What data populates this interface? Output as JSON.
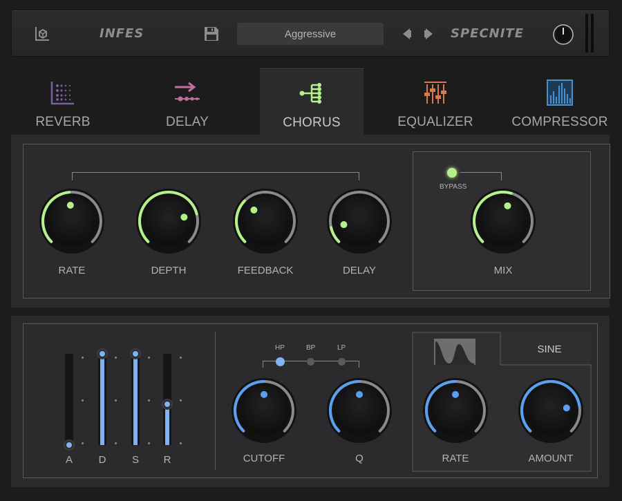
{
  "header": {
    "brand_left": "INFES",
    "preset_name": "Aggressive",
    "brand_right": "SPECNITE"
  },
  "tabs": [
    {
      "label": "REVERB",
      "icon": "reverb-dots-icon",
      "color": "#7a5fa0"
    },
    {
      "label": "DELAY",
      "icon": "delay-arrow-icon",
      "color": "#c06e9a"
    },
    {
      "label": "CHORUS",
      "icon": "chorus-tree-icon",
      "color": "#b6f08a",
      "active": true
    },
    {
      "label": "EQUALIZER",
      "icon": "equalizer-sliders-icon",
      "color": "#d87a4e"
    },
    {
      "label": "COMPRESSOR",
      "icon": "compressor-meter-icon",
      "color": "#4a8fcf"
    }
  ],
  "chorus": {
    "knobs": [
      {
        "label": "RATE",
        "value": 0.48
      },
      {
        "label": "DEPTH",
        "value": 0.78
      },
      {
        "label": "FEEDBACK",
        "value": 0.33
      },
      {
        "label": "DELAY",
        "value": 0.12
      }
    ],
    "bypass_label": "BYPASS",
    "mix": {
      "label": "MIX",
      "value": 0.56
    },
    "accent": "#b6f08a"
  },
  "envelope": {
    "sliders": [
      {
        "label": "A",
        "value": 0.0
      },
      {
        "label": "D",
        "value": 1.0
      },
      {
        "label": "S",
        "value": 1.0
      },
      {
        "label": "R",
        "value": 0.45
      }
    ]
  },
  "filter": {
    "modes": [
      "HP",
      "BP",
      "LP"
    ],
    "selected_mode": "HP",
    "knobs": [
      {
        "label": "CUTOFF",
        "value": 0.5
      },
      {
        "label": "Q",
        "value": 0.5
      }
    ]
  },
  "lfo": {
    "shape_label": "SINE",
    "knobs": [
      {
        "label": "RATE",
        "value": 0.5
      },
      {
        "label": "AMOUNT",
        "value": 0.8
      }
    ],
    "accent": "#5aa0f0"
  }
}
